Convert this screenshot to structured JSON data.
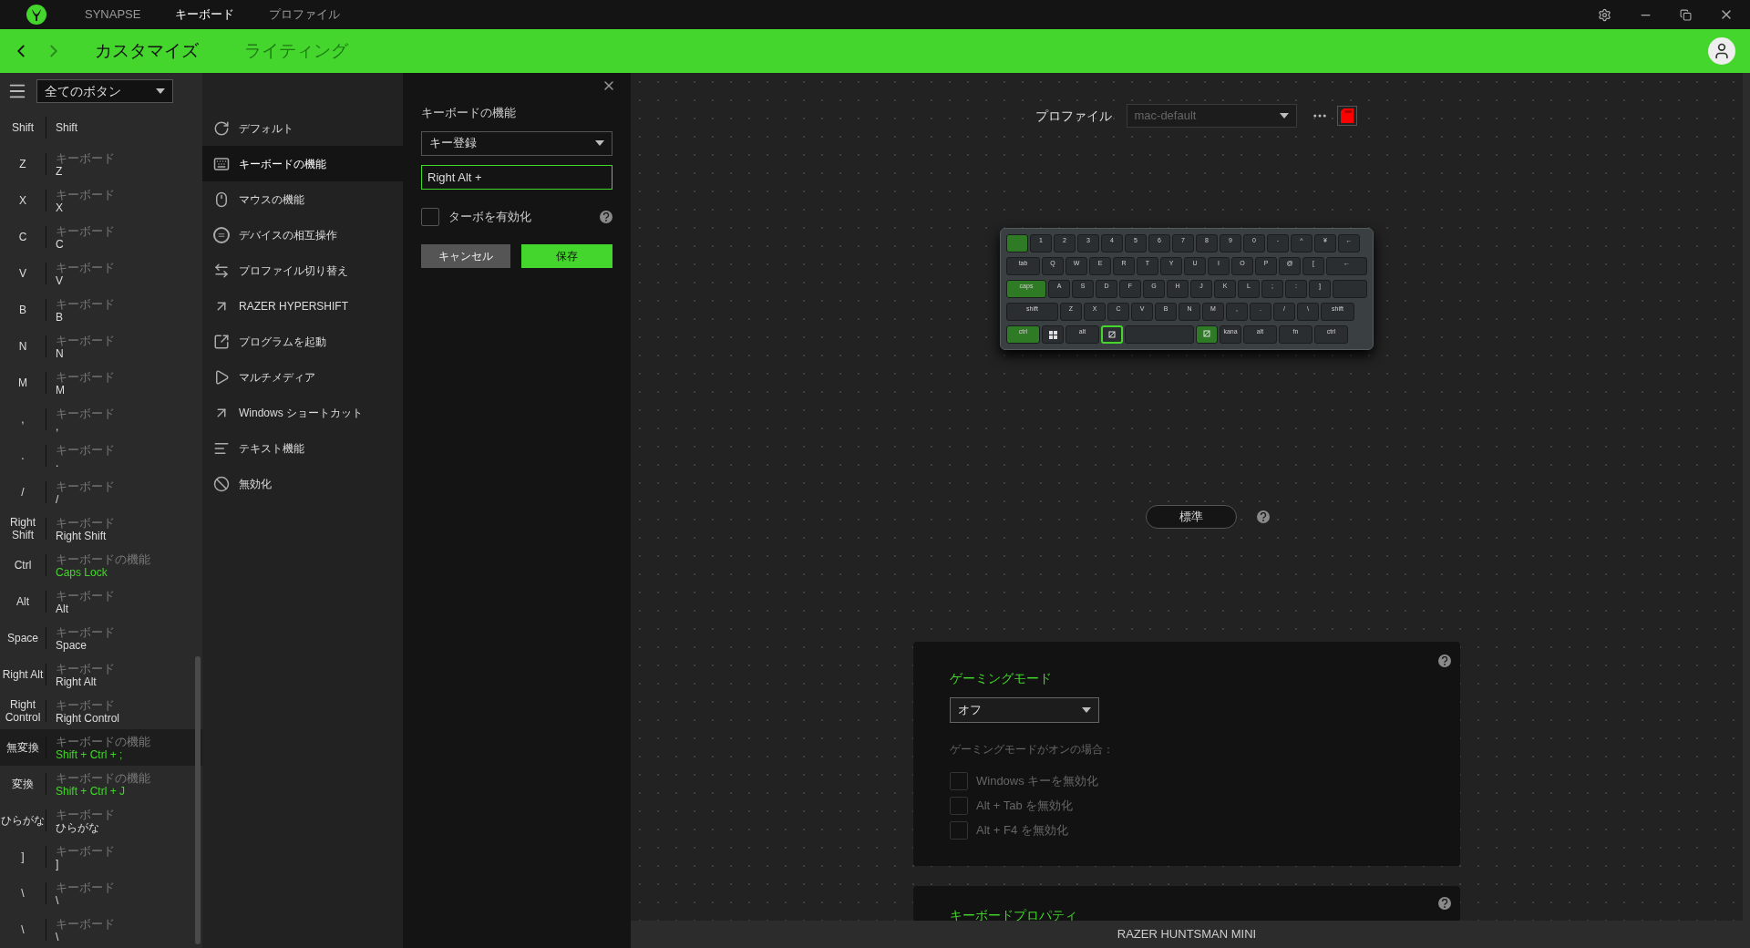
{
  "title_bar": {
    "brand": "SYNAPSE",
    "tabs": [
      {
        "label": "キーボード",
        "selected": true
      },
      {
        "label": "プロファイル",
        "selected": false
      }
    ]
  },
  "nav_bar": {
    "tabs": [
      {
        "label": "カスタマイズ",
        "selected": true
      },
      {
        "label": "ライティング",
        "selected": false
      }
    ]
  },
  "button_list": {
    "filter": "全てのボタン",
    "rows": [
      {
        "key": "Shift",
        "value": "Shift",
        "remapped": false,
        "selected": false
      },
      {
        "key": "Z",
        "category": "キーボード",
        "value": "Z",
        "remapped": false,
        "selected": false
      },
      {
        "key": "X",
        "category": "キーボード",
        "value": "X",
        "remapped": false,
        "selected": false
      },
      {
        "key": "C",
        "category": "キーボード",
        "value": "C",
        "remapped": false,
        "selected": false
      },
      {
        "key": "V",
        "category": "キーボード",
        "value": "V",
        "remapped": false,
        "selected": false
      },
      {
        "key": "B",
        "category": "キーボード",
        "value": "B",
        "remapped": false,
        "selected": false
      },
      {
        "key": "N",
        "category": "キーボード",
        "value": "N",
        "remapped": false,
        "selected": false
      },
      {
        "key": "M",
        "category": "キーボード",
        "value": "M",
        "remapped": false,
        "selected": false
      },
      {
        "key": ",",
        "category": "キーボード",
        "value": ",",
        "remapped": false,
        "selected": false
      },
      {
        "key": ".",
        "category": "キーボード",
        "value": ".",
        "remapped": false,
        "selected": false
      },
      {
        "key": "/",
        "category": "キーボード",
        "value": "/",
        "remapped": false,
        "selected": false
      },
      {
        "key": "Right Shift",
        "category": "キーボード",
        "value": "Right Shift",
        "remapped": false,
        "selected": false
      },
      {
        "key": "Ctrl",
        "category": "キーボードの機能",
        "value": "Caps Lock",
        "remapped": true,
        "selected": false
      },
      {
        "key": "Alt",
        "category": "キーボード",
        "value": "Alt",
        "remapped": false,
        "selected": false
      },
      {
        "key": "Space",
        "category": "キーボード",
        "value": "Space",
        "remapped": false,
        "selected": false
      },
      {
        "key": "Right Alt",
        "category": "キーボード",
        "value": "Right Alt",
        "remapped": false,
        "selected": false
      },
      {
        "key": "Right Control",
        "category": "キーボード",
        "value": "Right Control",
        "remapped": false,
        "selected": false
      },
      {
        "key": "無変換",
        "category": "キーボードの機能",
        "value": "Shift + Ctrl + ;",
        "remapped": true,
        "selected": true
      },
      {
        "key": "変換",
        "category": "キーボードの機能",
        "value": "Shift + Ctrl + J",
        "remapped": true,
        "selected": false
      },
      {
        "key": "ひらがな",
        "category": "キーボード",
        "value": "ひらがな",
        "remapped": false,
        "selected": false
      },
      {
        "key": "]",
        "category": "キーボード",
        "value": "]",
        "remapped": false,
        "selected": false
      },
      {
        "key": "\\",
        "category": "キーボード",
        "value": "\\",
        "remapped": false,
        "selected": false
      },
      {
        "key": "\\",
        "category": "キーボード",
        "value": "\\",
        "remapped": false,
        "selected": false
      }
    ]
  },
  "function_menu": [
    {
      "label": "デフォルト",
      "selected": false
    },
    {
      "label": "キーボードの機能",
      "selected": true
    },
    {
      "label": "マウスの機能",
      "selected": false
    },
    {
      "label": "デバイスの相互操作",
      "selected": false
    },
    {
      "label": "プロファイル切り替え",
      "selected": false
    },
    {
      "label": "RAZER HYPERSHIFT",
      "selected": false
    },
    {
      "label": "プログラムを起動",
      "selected": false
    },
    {
      "label": "マルチメディア",
      "selected": false
    },
    {
      "label": "Windows ショートカット",
      "selected": false
    },
    {
      "label": "テキスト機能",
      "selected": false
    },
    {
      "label": "無効化",
      "selected": false
    }
  ],
  "config_panel": {
    "title": "キーボードの機能",
    "mode": "キー登録",
    "keystroke": "Right Alt +",
    "turbo": {
      "label": "ターボを有効化",
      "checked": false
    },
    "cancel": "キャンセル",
    "save": "保存"
  },
  "profile": {
    "label": "プロファイル",
    "value": "mac-default"
  },
  "keyboard": {
    "rows": [
      [
        {
          "kind": "standard",
          "mapped": true,
          "selected": false
        },
        {
          "kind": "standard",
          "legend": "1",
          "mapped": false,
          "selected": false
        },
        {
          "kind": "standard",
          "legend": "2",
          "mapped": false,
          "selected": false
        },
        {
          "kind": "standard",
          "legend": "3",
          "mapped": false,
          "selected": false
        },
        {
          "kind": "standard",
          "legend": "4",
          "mapped": false,
          "selected": false
        },
        {
          "kind": "standard",
          "legend": "5",
          "mapped": false,
          "selected": false
        },
        {
          "kind": "standard",
          "legend": "6",
          "mapped": false,
          "selected": false
        },
        {
          "kind": "standard",
          "legend": "7",
          "mapped": false,
          "selected": false
        },
        {
          "kind": "standard",
          "legend": "8",
          "mapped": false,
          "selected": false
        },
        {
          "kind": "standard",
          "legend": "9",
          "mapped": false,
          "selected": false
        },
        {
          "kind": "standard",
          "legend": "0",
          "mapped": false,
          "selected": false
        },
        {
          "kind": "standard",
          "legend": "-",
          "mapped": false,
          "selected": false
        },
        {
          "kind": "standard",
          "legend": "^",
          "mapped": false,
          "selected": false
        },
        {
          "kind": "standard",
          "legend": "¥",
          "mapped": false,
          "selected": false
        },
        {
          "kind": "standard",
          "legend": "←",
          "mapped": false,
          "selected": false
        }
      ],
      [
        {
          "kind": "wide",
          "legend": "tab",
          "mapped": false,
          "selected": false
        },
        {
          "kind": "standard",
          "legend": "Q",
          "mapped": false,
          "selected": false
        },
        {
          "kind": "standard",
          "legend": "W",
          "mapped": false,
          "selected": false
        },
        {
          "kind": "standard",
          "legend": "E",
          "mapped": false,
          "selected": false
        },
        {
          "kind": "standard",
          "legend": "R",
          "mapped": false,
          "selected": false
        },
        {
          "kind": "standard",
          "legend": "T",
          "mapped": false,
          "selected": false
        },
        {
          "kind": "standard",
          "legend": "Y",
          "mapped": false,
          "selected": false
        },
        {
          "kind": "standard",
          "legend": "U",
          "mapped": false,
          "selected": false
        },
        {
          "kind": "standard",
          "legend": "I",
          "mapped": false,
          "selected": false
        },
        {
          "kind": "standard",
          "legend": "O",
          "mapped": false,
          "selected": false
        },
        {
          "kind": "standard",
          "legend": "P",
          "mapped": false,
          "selected": false
        },
        {
          "kind": "standard",
          "legend": "@",
          "mapped": false,
          "selected": false
        },
        {
          "kind": "standard",
          "legend": "[",
          "mapped": false,
          "selected": false
        },
        {
          "kind": "enter",
          "legend": "←",
          "mapped": false,
          "selected": false
        }
      ],
      [
        {
          "kind": "wider",
          "legend": "caps",
          "mapped": true,
          "selected": false
        },
        {
          "kind": "standard",
          "legend": "A",
          "mapped": false,
          "selected": false
        },
        {
          "kind": "standard",
          "legend": "S",
          "mapped": false,
          "selected": false
        },
        {
          "kind": "standard",
          "legend": "D",
          "mapped": false,
          "selected": false
        },
        {
          "kind": "standard",
          "legend": "F",
          "mapped": false,
          "selected": false
        },
        {
          "kind": "standard",
          "legend": "G",
          "mapped": false,
          "selected": false
        },
        {
          "kind": "standard",
          "legend": "H",
          "mapped": false,
          "selected": false
        },
        {
          "kind": "standard",
          "legend": "J",
          "mapped": false,
          "selected": false
        },
        {
          "kind": "standard",
          "legend": "K",
          "mapped": false,
          "selected": false
        },
        {
          "kind": "standard",
          "legend": "L",
          "mapped": false,
          "selected": false
        },
        {
          "kind": "standard",
          "legend": ";",
          "mapped": false,
          "selected": false
        },
        {
          "kind": "standard",
          "legend": ":",
          "mapped": false,
          "selected": false
        },
        {
          "kind": "standard",
          "legend": "]",
          "mapped": false,
          "selected": false
        },
        {
          "kind": "enter",
          "mapped": false,
          "selected": false
        }
      ],
      [
        {
          "kind": "widest",
          "legend": "shift",
          "mapped": false,
          "selected": false
        },
        {
          "kind": "standard",
          "legend": "Z",
          "mapped": false,
          "selected": false
        },
        {
          "kind": "standard",
          "legend": "X",
          "mapped": false,
          "selected": false
        },
        {
          "kind": "standard",
          "legend": "C",
          "mapped": false,
          "selected": false
        },
        {
          "kind": "standard",
          "legend": "V",
          "mapped": false,
          "selected": false
        },
        {
          "kind": "standard",
          "legend": "B",
          "mapped": false,
          "selected": false
        },
        {
          "kind": "standard",
          "legend": "N",
          "mapped": false,
          "selected": false
        },
        {
          "kind": "standard",
          "legend": "M",
          "mapped": false,
          "selected": false
        },
        {
          "kind": "standard",
          "legend": ",",
          "mapped": false,
          "selected": false
        },
        {
          "kind": "standard",
          "legend": ".",
          "mapped": false,
          "selected": false
        },
        {
          "kind": "standard",
          "legend": "/",
          "mapped": false,
          "selected": false
        },
        {
          "kind": "standard",
          "legend": "\\",
          "mapped": false,
          "selected": false
        },
        {
          "kind": "wide",
          "legend": "shift",
          "mapped": false,
          "selected": false
        }
      ],
      [
        {
          "kind": "wide",
          "legend": "ctrl",
          "mapped": true,
          "selected": false
        },
        {
          "kind": "windows",
          "mapped": false,
          "selected": false
        },
        {
          "kind": "wide",
          "legend": "alt",
          "mapped": false,
          "selected": false
        },
        {
          "kind": "function",
          "mapped": false,
          "selected": true
        },
        {
          "kind": "space",
          "mapped": false,
          "selected": false
        },
        {
          "kind": "function",
          "mapped": true,
          "selected": false
        },
        {
          "kind": "standard",
          "legend": "kana",
          "mapped": false,
          "selected": false
        },
        {
          "kind": "wide",
          "legend": "alt",
          "mapped": false,
          "selected": false
        },
        {
          "kind": "wide",
          "legend": "fn",
          "mapped": false,
          "selected": false
        },
        {
          "kind": "wide",
          "legend": "ctrl",
          "mapped": false,
          "selected": false
        }
      ]
    ]
  },
  "layer_button": "標準",
  "gaming_mode": {
    "title": "ゲーミングモード",
    "value": "オフ",
    "subtitle": "ゲーミングモードがオンの場合：",
    "options": [
      {
        "label": "Windows キーを無効化",
        "checked": false,
        "disabled": true
      },
      {
        "label": "Alt + Tab を無効化",
        "checked": false,
        "disabled": true
      },
      {
        "label": "Alt + F4 を無効化",
        "checked": false,
        "disabled": true
      }
    ]
  },
  "keyboard_properties": {
    "title": "キーボードプロパティ"
  },
  "status_bar": "RAZER HUNTSMAN MINI"
}
